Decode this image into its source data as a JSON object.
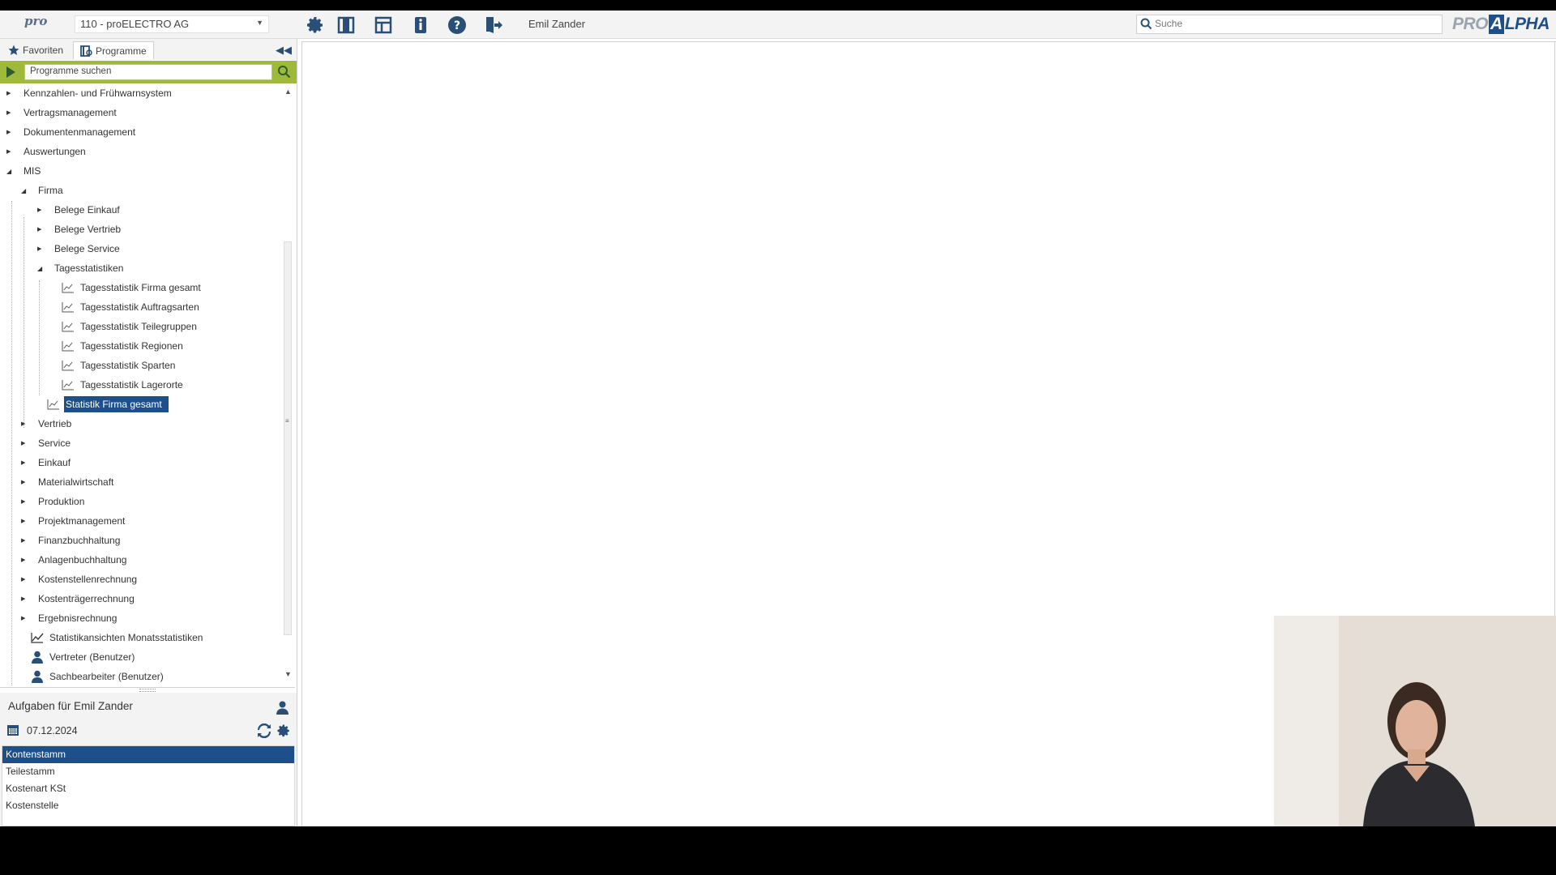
{
  "header": {
    "logo_text": "pro",
    "company_select": "110 - proELECTRO AG",
    "toolbar_icons": [
      "gear-icon",
      "panel-columns-icon",
      "layout-icon",
      "info-icon",
      "help-icon",
      "exit-icon"
    ],
    "user_name": "Emil Zander",
    "search_placeholder": "Suche",
    "brand": {
      "pre": "PRO",
      "alpha": "A",
      "post": "LPHA"
    }
  },
  "left_panel": {
    "tabs": [
      {
        "label": "Favoriten",
        "icon": "star-icon",
        "active": false
      },
      {
        "label": "Programme",
        "icon": "programs-icon",
        "active": true
      }
    ],
    "program_search_placeholder": "Programme suchen",
    "tree": [
      {
        "label": "Kennzahlen- und Frühwarnsystem",
        "level": 0,
        "expand": "collapsed"
      },
      {
        "label": "Vertragsmanagement",
        "level": 0,
        "expand": "collapsed"
      },
      {
        "label": "Dokumentenmanagement",
        "level": 0,
        "expand": "collapsed"
      },
      {
        "label": "Auswertungen",
        "level": 0,
        "expand": "collapsed"
      },
      {
        "label": "MIS",
        "level": 0,
        "expand": "expanded"
      },
      {
        "label": "Firma",
        "level": 1,
        "expand": "expanded"
      },
      {
        "label": "Belege Einkauf",
        "level": 2,
        "expand": "collapsed"
      },
      {
        "label": "Belege Vertrieb",
        "level": 2,
        "expand": "collapsed"
      },
      {
        "label": "Belege Service",
        "level": 2,
        "expand": "collapsed"
      },
      {
        "label": "Tagesstatistiken",
        "level": 2,
        "expand": "expanded"
      },
      {
        "label": "Tagesstatistik Firma gesamt",
        "level": 3,
        "icon": "chart-icon"
      },
      {
        "label": "Tagesstatistik Auftragsarten",
        "level": 3,
        "icon": "chart-icon"
      },
      {
        "label": "Tagesstatistik Teilegruppen",
        "level": 3,
        "icon": "chart-icon"
      },
      {
        "label": "Tagesstatistik Regionen",
        "level": 3,
        "icon": "chart-icon"
      },
      {
        "label": "Tagesstatistik Sparten",
        "level": 3,
        "icon": "chart-icon"
      },
      {
        "label": "Tagesstatistik Lagerorte",
        "level": 3,
        "icon": "chart-icon"
      },
      {
        "label": "Statistik Firma gesamt",
        "level": 2,
        "icon": "chart-icon",
        "selected": true
      },
      {
        "label": "Vertrieb",
        "level": 1,
        "expand": "collapsed"
      },
      {
        "label": "Service",
        "level": 1,
        "expand": "collapsed"
      },
      {
        "label": "Einkauf",
        "level": 1,
        "expand": "collapsed"
      },
      {
        "label": "Materialwirtschaft",
        "level": 1,
        "expand": "collapsed"
      },
      {
        "label": "Produktion",
        "level": 1,
        "expand": "collapsed"
      },
      {
        "label": "Projektmanagement",
        "level": 1,
        "expand": "collapsed"
      },
      {
        "label": "Finanzbuchhaltung",
        "level": 1,
        "expand": "collapsed"
      },
      {
        "label": "Anlagenbuchhaltung",
        "level": 1,
        "expand": "collapsed"
      },
      {
        "label": "Kostenstellenrechnung",
        "level": 1,
        "expand": "collapsed"
      },
      {
        "label": "Kostenträgerrechnung",
        "level": 1,
        "expand": "collapsed"
      },
      {
        "label": "Ergebnisrechnung",
        "level": 1,
        "expand": "collapsed"
      },
      {
        "label": "Statistikansichten Monatsstatistiken",
        "level": 1,
        "icon": "trend-icon"
      },
      {
        "label": "Vertreter (Benutzer)",
        "level": 1,
        "icon": "user-icon"
      },
      {
        "label": "Sachbearbeiter (Benutzer)",
        "level": 1,
        "icon": "user-icon"
      }
    ]
  },
  "tasks": {
    "title": "Aufgaben für Emil Zander",
    "date": "07.12.2024",
    "items": [
      {
        "label": "Kontenstamm",
        "selected": true
      },
      {
        "label": "Teilestamm",
        "selected": false
      },
      {
        "label": "Kostenart KSt",
        "selected": false
      },
      {
        "label": "Kostenstelle",
        "selected": false
      }
    ]
  },
  "colors": {
    "accent_blue": "#1d4f8a",
    "search_bar_green": "#9fba3b",
    "icon_blue": "#2a4f77"
  }
}
